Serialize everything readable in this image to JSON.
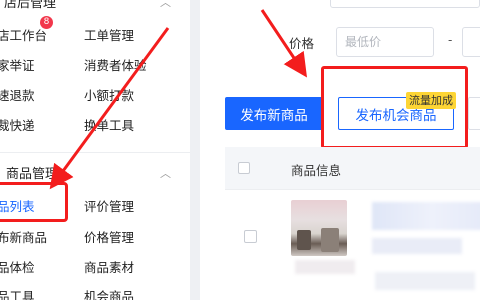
{
  "sidebar": {
    "badge": "8",
    "group1": {
      "title": "店后管理",
      "items": [
        {
          "label": "店工作台"
        },
        {
          "label": "工单管理"
        },
        {
          "label": "家举证"
        },
        {
          "label": "消费者体验"
        },
        {
          "label": "速退款"
        },
        {
          "label": "小额打款"
        },
        {
          "label": "裁快递"
        },
        {
          "label": "换单工具"
        }
      ]
    },
    "group2": {
      "title": "商品管理",
      "items": [
        {
          "label": "品列表"
        },
        {
          "label": "评价管理"
        },
        {
          "label": "布新商品"
        },
        {
          "label": "价格管理"
        },
        {
          "label": "品体检"
        },
        {
          "label": "商品素材"
        },
        {
          "label": "品工具"
        },
        {
          "label": "机会商品"
        }
      ]
    }
  },
  "filters": {
    "price_label": "价格",
    "min_price_placeholder": "最低价",
    "dash": "-"
  },
  "actions": {
    "publish_new": "发布新商品",
    "publish_opportunity": "发布机会商品",
    "traffic_tag": "流量加成"
  },
  "table": {
    "header_product_info": "商品信息"
  },
  "colors": {
    "brand_blue": "#1966ff",
    "annotation_red": "#f31d1d",
    "tag_yellow": "#fdd535",
    "badge_red": "#f2374b"
  }
}
